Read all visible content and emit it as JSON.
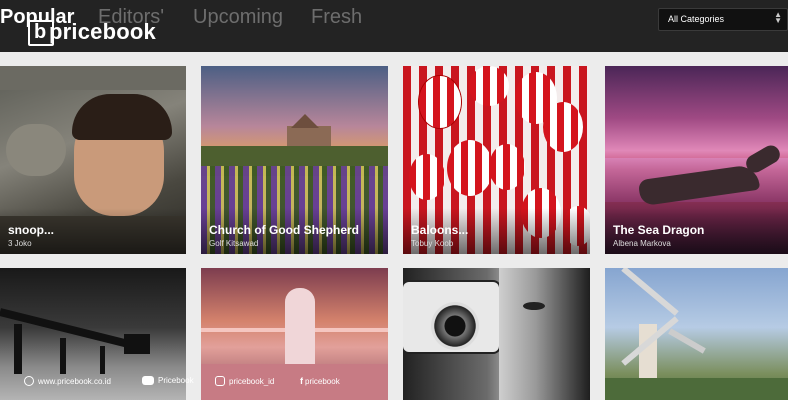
{
  "header": {
    "tabs": [
      {
        "label": "Popular",
        "active": true
      },
      {
        "label": "Editors'",
        "active": false
      },
      {
        "label": "Upcoming",
        "active": false
      },
      {
        "label": "Fresh",
        "active": false
      }
    ],
    "logo_text": "pricebook",
    "logo_letter": "b",
    "category_select": {
      "value": "All Categories"
    }
  },
  "photos": [
    {
      "title": "snoop...",
      "author": "3 Joko"
    },
    {
      "title": "Church of Good Shepherd",
      "author": "Golf Kitsawad"
    },
    {
      "title": "Baloons...",
      "author": "Tobuy Koob"
    },
    {
      "title": "The Sea Dragon",
      "author": "Albena Markova"
    },
    {
      "title": "",
      "author": ""
    },
    {
      "title": "",
      "author": ""
    },
    {
      "title": "",
      "author": ""
    },
    {
      "title": "",
      "author": ""
    }
  ],
  "watermark": {
    "website": "www.pricebook.co.id",
    "youtube": "Pricebook",
    "instagram": "pricebook_id",
    "facebook": "pricebook"
  },
  "colors": {
    "topbar": "#232323",
    "page_background": "#ececec",
    "active_tab": "#ffffff",
    "inactive_tab": "#6d6d6d"
  }
}
